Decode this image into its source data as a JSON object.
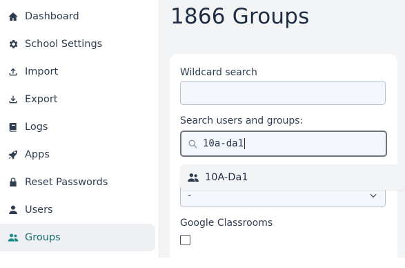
{
  "sidebar": {
    "items": [
      {
        "label": "Dashboard",
        "icon": "home-icon"
      },
      {
        "label": "School Settings",
        "icon": "gear-icon"
      },
      {
        "label": "Import",
        "icon": "upload-icon"
      },
      {
        "label": "Export",
        "icon": "download-icon"
      },
      {
        "label": "Logs",
        "icon": "book-icon"
      },
      {
        "label": "Apps",
        "icon": "rocket-icon"
      },
      {
        "label": "Reset Passwords",
        "icon": "lock-icon"
      },
      {
        "label": "Users",
        "icon": "user-icon"
      },
      {
        "label": "Groups",
        "icon": "users-icon",
        "active": true
      }
    ]
  },
  "main": {
    "title": "1866 Groups",
    "wildcard": {
      "label": "Wildcard search",
      "value": ""
    },
    "search": {
      "label": "Search users and groups:",
      "value": "10a-da1"
    },
    "select": {
      "value": "-"
    },
    "google": {
      "label": "Google Classrooms",
      "checked": false
    }
  },
  "dropdown": {
    "options": [
      {
        "label": "10A-Da1",
        "icon": "users-icon"
      }
    ]
  },
  "colors": {
    "accent": "#1a8a87",
    "active_bg": "#eef0f3",
    "text": "#1e2d42"
  }
}
